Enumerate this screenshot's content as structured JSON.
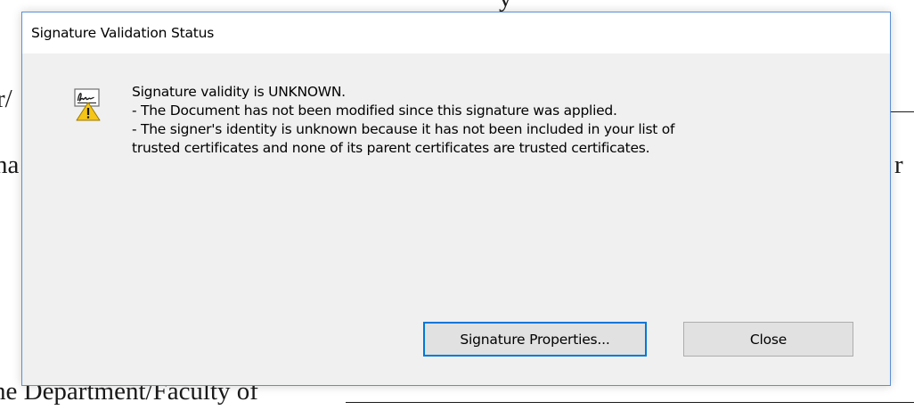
{
  "dialog": {
    "title": "Signature Validation Status",
    "icon": "signature-warning-icon",
    "message_lines": [
      "Signature validity is UNKNOWN.",
      "- The Document has not been modified since this signature was applied.",
      "- The signer's identity is unknown because it has not been included in your list of",
      "trusted certificates and none of its parent certificates are trusted certificates."
    ],
    "buttons": {
      "properties_label": "Signature Properties...",
      "close_label": "Close"
    },
    "colors": {
      "accent": "#0078d7",
      "border": "#5b8fd4",
      "body_bg": "#f0f0f0",
      "warning": "#f5c518"
    }
  },
  "background_document": {
    "fragments": {
      "top": "y",
      "left_1": "r/",
      "left_2": "na",
      "right": "r",
      "bottom": "he Department/Faculty of"
    }
  }
}
